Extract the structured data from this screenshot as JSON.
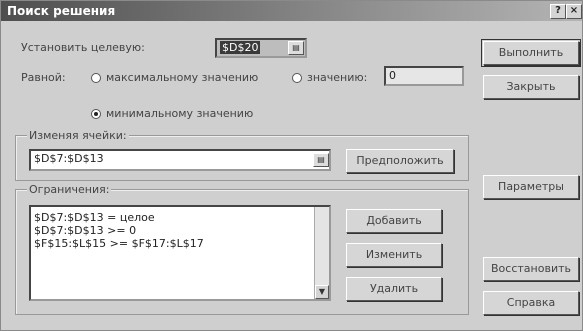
{
  "window": {
    "title": "Поиск решения",
    "help_button": "?",
    "close_button": "×"
  },
  "target": {
    "label": "Установить целевую:",
    "value": "$D$20"
  },
  "equal_to": {
    "label": "Равной:",
    "option_max": "максимальному значению",
    "option_value": "значению:",
    "value_field": "0",
    "option_min": "минимальному значению",
    "selected": "min"
  },
  "changing_cells": {
    "label": "Изменяя ячейки:",
    "value": "$D$7:$D$13",
    "guess_button": "Предположить"
  },
  "constraints": {
    "label": "Ограничения:",
    "items": [
      "$D$7:$D$13 = целое",
      "$D$7:$D$13 >= 0",
      "$F$15:$L$15 >= $F$17:$L$17"
    ],
    "add_button": "Добавить",
    "change_button": "Изменить",
    "delete_button": "Удалить"
  },
  "side_buttons": {
    "solve": "Выполнить",
    "close": "Закрыть",
    "options": "Параметры",
    "reset": "Восстановить",
    "help": "Справка"
  }
}
